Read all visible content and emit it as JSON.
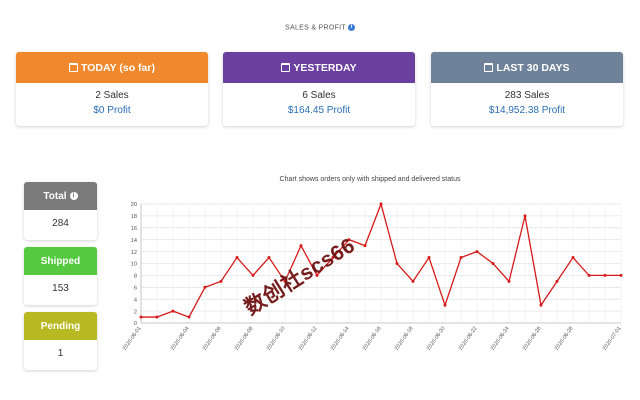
{
  "page_title": "SALES & PROFIT",
  "colors": {
    "today": "#f0892e",
    "yesterday": "#6b3fa0",
    "last30": "#6e8399",
    "total": "#7b7b7b",
    "shipped": "#55c93f",
    "pending": "#b8b822",
    "line": "#d61a1a",
    "profit_text": "#2a6db5"
  },
  "cards": [
    {
      "title": "TODAY (so far)",
      "sales": "2 Sales",
      "profit": "$0 Profit",
      "icon": "calendar-icon"
    },
    {
      "title": "YESTERDAY",
      "sales": "6 Sales",
      "profit": "$164.45 Profit",
      "icon": "calendar-icon"
    },
    {
      "title": "LAST 30 DAYS",
      "sales": "283 Sales",
      "profit": "$14,952.38 Profit",
      "icon": "calendar-icon"
    }
  ],
  "stats": [
    {
      "label": "Total",
      "value": "284",
      "icon": "info-icon"
    },
    {
      "label": "Shipped",
      "value": "153"
    },
    {
      "label": "Pending",
      "value": "1"
    }
  ],
  "chart_caption": "Chart shows orders only with shipped and delivered status",
  "watermark": "数创社scs66",
  "chart_data": {
    "type": "line",
    "title": "",
    "xlabel": "",
    "ylabel": "",
    "ylim": [
      0,
      20
    ],
    "yticks": [
      0,
      2,
      4,
      6,
      8,
      10,
      12,
      14,
      16,
      18,
      20
    ],
    "grid": true,
    "x": [
      "2020-06-01",
      "2020-06-02",
      "2020-06-03",
      "2020-06-04",
      "2020-06-05",
      "2020-06-06",
      "2020-06-07",
      "2020-06-08",
      "2020-06-09",
      "2020-06-10",
      "2020-06-11",
      "2020-06-12",
      "2020-06-13",
      "2020-06-14",
      "2020-06-15",
      "2020-06-16",
      "2020-06-17",
      "2020-06-18",
      "2020-06-19",
      "2020-06-20",
      "2020-06-21",
      "2020-06-22",
      "2020-06-23",
      "2020-06-24",
      "2020-06-25",
      "2020-06-26",
      "2020-06-27",
      "2020-06-28",
      "2020-06-29",
      "2020-06-30",
      "2020-07-01"
    ],
    "xtick_labels": [
      "2020-06-01",
      "2020-06-04",
      "2020-06-06",
      "2020-06-08",
      "2020-06-10",
      "2020-06-12",
      "2020-06-14",
      "2020-06-16",
      "2020-06-18",
      "2020-06-20",
      "2020-06-22",
      "2020-06-24",
      "2020-06-26",
      "2020-06-28",
      "2020-07-01"
    ],
    "series": [
      {
        "values": [
          1,
          1,
          2,
          1,
          6,
          7,
          11,
          8,
          11,
          7,
          13,
          8,
          11,
          14,
          13,
          20,
          10,
          7,
          11,
          3,
          11,
          12,
          10,
          7,
          18,
          3,
          7,
          11,
          8,
          8,
          8
        ]
      }
    ]
  }
}
